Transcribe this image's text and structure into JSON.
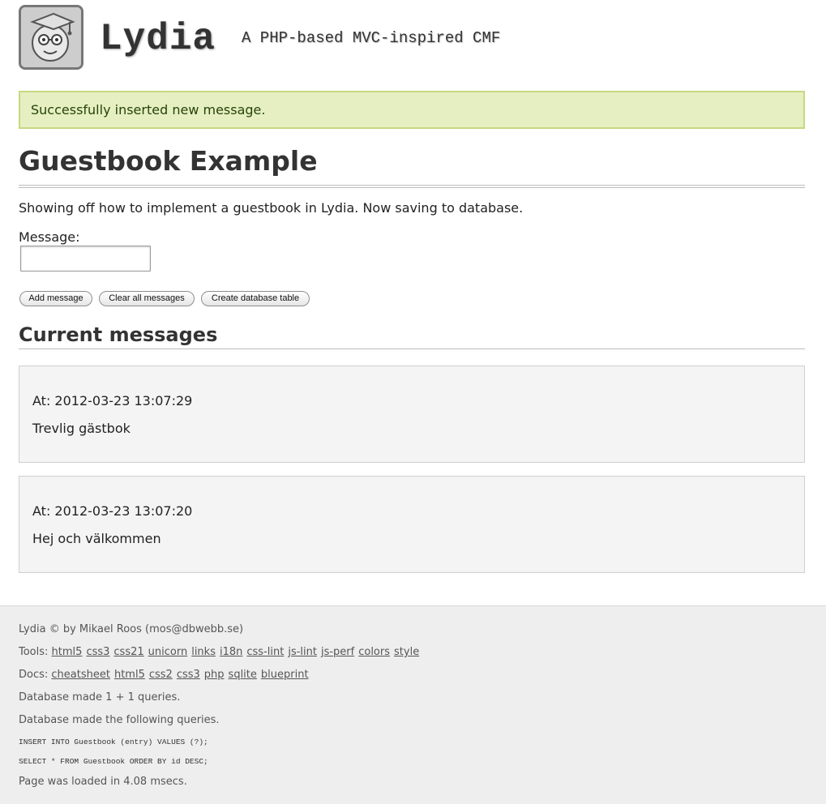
{
  "header": {
    "title": "Lydia",
    "slogan": "A PHP-based MVC-inspired CMF"
  },
  "flash": "Successfully inserted new message.",
  "main": {
    "title": "Guestbook Example",
    "intro": "Showing off how to implement a guestbook in Lydia. Now saving to database.",
    "form": {
      "message_label": "Message:",
      "message_value": "",
      "buttons": {
        "add": "Add message",
        "clear": "Clear all messages",
        "create": "Create database table"
      }
    },
    "messages_title": "Current messages",
    "messages": [
      {
        "time": "At: 2012-03-23 13:07:29",
        "text": "Trevlig gästbok"
      },
      {
        "time": "At: 2012-03-23 13:07:20",
        "text": "Hej och välkommen"
      }
    ]
  },
  "footer": {
    "credit": "Lydia © by Mikael Roos (mos@dbwebb.se)",
    "tools_label": "Tools:",
    "tools": [
      "html5",
      "css3",
      "css21",
      "unicorn",
      "links",
      "i18n",
      "css-lint",
      "js-lint",
      "js-perf",
      "colors",
      "style"
    ],
    "docs_label": "Docs:",
    "docs": [
      "cheatsheet",
      "html5",
      "css2",
      "css3",
      "php",
      "sqlite",
      "blueprint"
    ],
    "db_count": "Database made 1 + 1 queries.",
    "db_list_intro": "Database made the following queries.",
    "queries": [
      "INSERT INTO Guestbook (entry) VALUES (?);",
      "SELECT * FROM Guestbook ORDER BY id DESC;"
    ],
    "load_time": "Page was loaded in 4.08 msecs."
  }
}
